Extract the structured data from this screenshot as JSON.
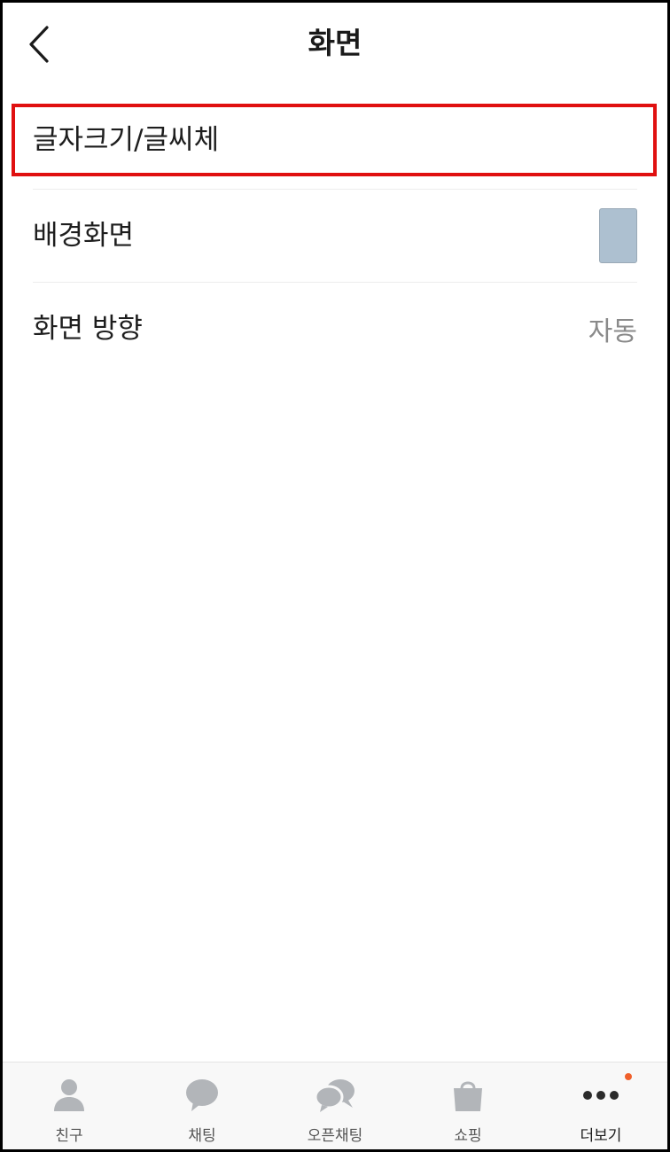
{
  "header": {
    "title": "화면"
  },
  "settings": {
    "items": [
      {
        "label": "글자크기/글씨체"
      },
      {
        "label": "배경화면"
      },
      {
        "label": "화면 방향",
        "value": "자동"
      }
    ]
  },
  "nav": {
    "items": [
      {
        "label": "친구",
        "icon": "person-icon"
      },
      {
        "label": "채팅",
        "icon": "chat-bubble-icon"
      },
      {
        "label": "오픈채팅",
        "icon": "open-chat-icon"
      },
      {
        "label": "쇼핑",
        "icon": "shopping-bag-icon"
      },
      {
        "label": "더보기",
        "icon": "more-dots-icon",
        "active": true,
        "badge": true
      }
    ]
  },
  "colors": {
    "highlight": "#e01010",
    "swatch": "#adc0d0",
    "badge": "#f0602b",
    "nav_icon": "#b2b5b9"
  }
}
